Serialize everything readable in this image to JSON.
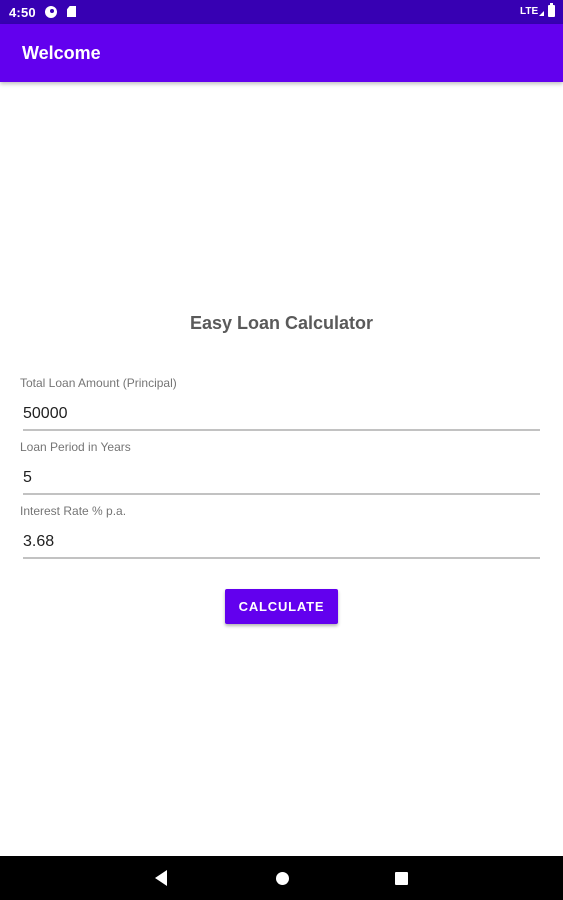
{
  "status_bar": {
    "time": "4:50",
    "network": "LTE",
    "icons": [
      "pocket-casts-icon",
      "sd-card-icon",
      "signal-icon",
      "battery-icon"
    ]
  },
  "app_bar": {
    "title": "Welcome",
    "color": "#6200ee"
  },
  "main": {
    "heading": "Easy Loan Calculator",
    "fields": {
      "principal": {
        "label": "Total Loan Amount (Principal)",
        "value": "50000"
      },
      "period": {
        "label": "Loan Period in Years",
        "value": "5"
      },
      "rate": {
        "label": "Interest Rate % p.a.",
        "value": "3.68"
      }
    },
    "calculate_label": "CALCULATE"
  },
  "nav_bar": {
    "icons": [
      "back-icon",
      "home-icon",
      "recents-icon"
    ]
  },
  "colors": {
    "status_bar": "#3700b3",
    "primary": "#6200ee"
  }
}
